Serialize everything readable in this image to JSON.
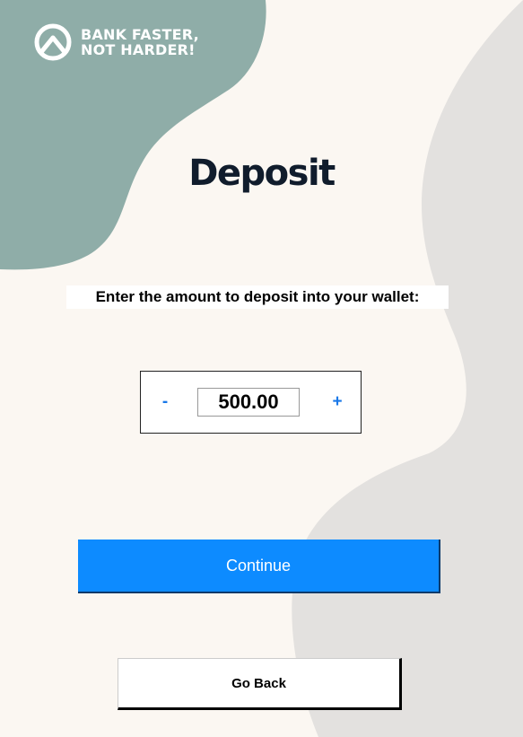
{
  "brand": {
    "logo_icon": "upward-chevron-circle-icon",
    "line1": "BANK FASTER,",
    "line2": "NOT HARDER!"
  },
  "page": {
    "title": "Deposit",
    "prompt": "Enter the amount to deposit into your wallet:"
  },
  "amount_stepper": {
    "decrement_label": "-",
    "value": "500.00",
    "increment_label": "+"
  },
  "buttons": {
    "continue_label": "Continue",
    "go_back_label": "Go Back"
  },
  "colors": {
    "background": "#fbf7f2",
    "teal_shape": "#8fada8",
    "grey_shape": "#e3e1df",
    "title": "#101c2c",
    "accent_blue": "#0d8bff",
    "stepper_blue": "#1a78e8"
  }
}
